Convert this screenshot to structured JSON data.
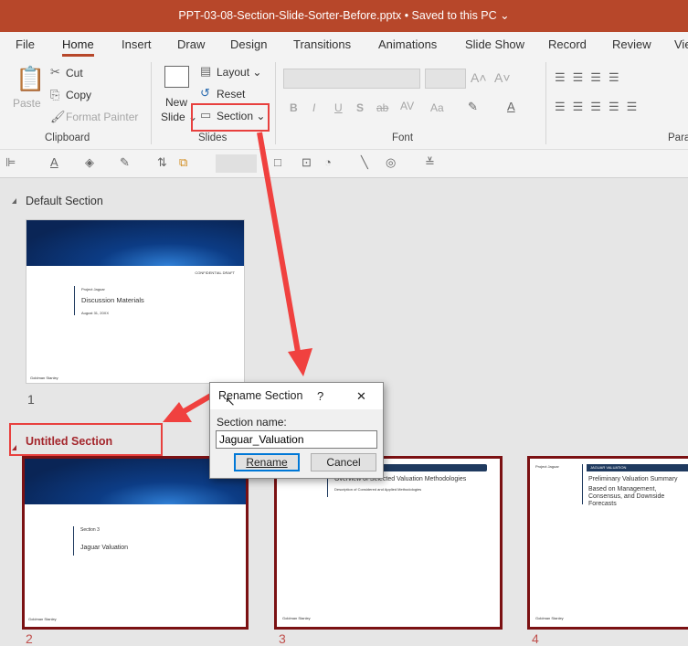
{
  "window": {
    "title": "PPT-03-08-Section-Slide-Sorter-Before.pptx  •  Saved to this PC ⌄"
  },
  "tabs": [
    "File",
    "Home",
    "Insert",
    "Draw",
    "Design",
    "Transitions",
    "Animations",
    "Slide Show",
    "Record",
    "Review",
    "Vie"
  ],
  "ribbon": {
    "clipboard": {
      "paste": "Paste",
      "cut": "Cut",
      "copy": "Copy",
      "format_painter": "Format Painter",
      "label": "Clipboard"
    },
    "slides": {
      "new_slide_1": "New",
      "new_slide_2": "Slide ⌄",
      "layout": "Layout ⌄",
      "reset": "Reset",
      "section": "Section ⌄",
      "label": "Slides"
    },
    "font": {
      "label": "Font",
      "bold": "B",
      "italic": "I",
      "underline": "U",
      "strike": "S",
      "abc": "ab",
      "spacing": "AV",
      "case": "Aa",
      "grow": "A˄",
      "shrink": "A˅"
    },
    "paragraph": {
      "label": "Para"
    }
  },
  "sections": [
    {
      "name": "Default Section",
      "slides": [
        {
          "number": "1",
          "project": "Project Jaguar",
          "title": "Discussion Materials",
          "date": "August 31, 20XX",
          "footer": "Goldman Stanley",
          "confidential": "CONFIDENTIAL DRAFT"
        }
      ]
    },
    {
      "name": "Untitled Section",
      "slides": [
        {
          "number": "2",
          "kicker": "Section 3",
          "title": "Jaguar Valuation",
          "footer": "Goldman Stanley"
        },
        {
          "number": "3",
          "title": "Overview of Selected Valuation Methodologies",
          "subtitle": "Description of Considered and Applied Methodologies",
          "footer": "Goldman Stanley"
        },
        {
          "number": "4",
          "project": "Project Jaguar",
          "tag": "JAGUAR VALUATION",
          "title": "Preliminary Valuation Summary",
          "subtitle": "Based on Management, Consensus, and Downside Forecasts",
          "footer": "Goldman Stanley"
        }
      ]
    }
  ],
  "dialog": {
    "title": "Rename Section",
    "help": "?",
    "close": "✕",
    "label": "Section name:",
    "value": "Jaguar_Valuation",
    "rename": "Rename",
    "cancel": "Cancel"
  },
  "colors": {
    "accent": "#b7472a",
    "section_selected": "#a4262c",
    "annotation": "#f0413f"
  }
}
